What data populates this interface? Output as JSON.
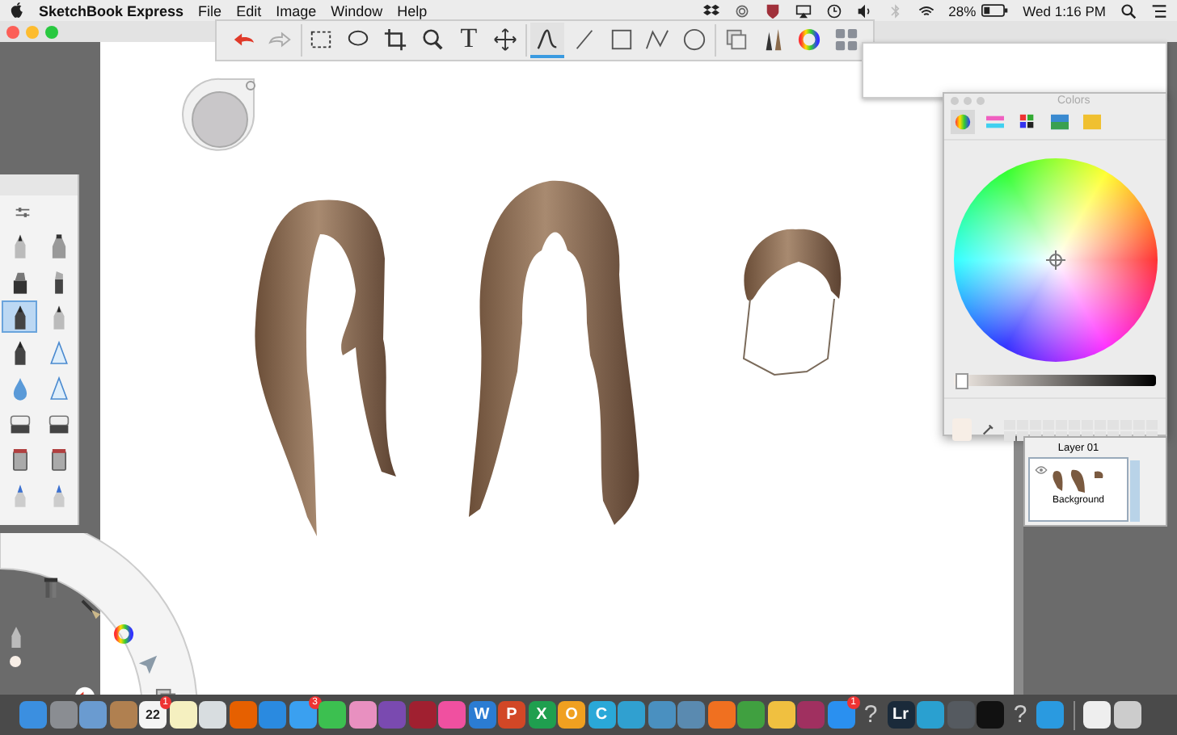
{
  "menu_bar": {
    "app_name": "SketchBook Express",
    "menus": [
      "File",
      "Edit",
      "Image",
      "Window",
      "Help"
    ],
    "battery": "28%",
    "clock": "Wed 1:16 PM"
  },
  "toolbar": {
    "tools": [
      {
        "kind": "undo",
        "selected": false
      },
      {
        "kind": "redo",
        "selected": false
      },
      {
        "kind": "rect-select",
        "selected": false
      },
      {
        "kind": "lasso",
        "selected": false
      },
      {
        "kind": "crop",
        "selected": false
      },
      {
        "kind": "zoom",
        "selected": false
      },
      {
        "kind": "text",
        "label": "T",
        "selected": false
      },
      {
        "kind": "move",
        "selected": false
      },
      {
        "kind": "curve",
        "selected": true
      },
      {
        "kind": "line",
        "selected": false
      },
      {
        "kind": "rect",
        "selected": false
      },
      {
        "kind": "polyline",
        "selected": false
      },
      {
        "kind": "ellipse",
        "selected": false
      },
      {
        "kind": "layers",
        "selected": false
      },
      {
        "kind": "brushes",
        "selected": false
      },
      {
        "kind": "color",
        "selected": false
      },
      {
        "kind": "panels",
        "selected": false
      }
    ]
  },
  "brush_palette": {
    "brushes": [
      {
        "kind": "pencil",
        "selected": false
      },
      {
        "kind": "airbrush",
        "selected": false
      },
      {
        "kind": "marker",
        "selected": false
      },
      {
        "kind": "chisel",
        "selected": false
      },
      {
        "kind": "pen",
        "selected": true
      },
      {
        "kind": "pencil",
        "selected": false
      },
      {
        "kind": "pen",
        "selected": false
      },
      {
        "kind": "triangle",
        "selected": false
      },
      {
        "kind": "drop",
        "selected": false
      },
      {
        "kind": "triangle",
        "selected": false
      },
      {
        "kind": "eraser",
        "selected": false
      },
      {
        "kind": "eraser",
        "selected": false
      },
      {
        "kind": "bucket",
        "selected": false
      },
      {
        "kind": "bucket",
        "selected": false
      },
      {
        "kind": "highlighter",
        "selected": false
      },
      {
        "kind": "highlighter",
        "selected": false
      }
    ]
  },
  "colors_panel": {
    "title": "Colors",
    "tabs": [
      {
        "kind": "wheel",
        "selected": true
      },
      {
        "kind": "sliders",
        "selected": false
      },
      {
        "kind": "palette",
        "selected": false
      },
      {
        "kind": "image",
        "selected": false
      },
      {
        "kind": "crayons",
        "selected": false
      }
    ],
    "brightness": {
      "level": 0.03
    }
  },
  "layers_panel": {
    "layers": [
      {
        "name": "Layer 01"
      },
      {
        "name": "Background",
        "selected": true
      }
    ]
  },
  "dock": [
    {
      "kind": "app",
      "color": "#3b8fe0"
    },
    {
      "kind": "app",
      "color": "#8a8d92"
    },
    {
      "kind": "app",
      "color": "#6a9bd0"
    },
    {
      "kind": "app",
      "color": "#b08050"
    },
    {
      "kind": "app",
      "color": "#f4f4f4",
      "label": "22",
      "badge": "1"
    },
    {
      "kind": "app",
      "color": "#f5f0c0"
    },
    {
      "kind": "app",
      "color": "#d8dde0"
    },
    {
      "kind": "app",
      "color": "#e66000"
    },
    {
      "kind": "app",
      "color": "#2a8ae0"
    },
    {
      "kind": "app",
      "color": "#3aa0f0",
      "badge": "3"
    },
    {
      "kind": "app",
      "color": "#3cc050"
    },
    {
      "kind": "app",
      "color": "#e890c0"
    },
    {
      "kind": "app",
      "color": "#7a4ab0"
    },
    {
      "kind": "app",
      "color": "#a02030"
    },
    {
      "kind": "app",
      "color": "#f050a0"
    },
    {
      "kind": "app",
      "color": "#2b7cd3",
      "label": "W"
    },
    {
      "kind": "app",
      "color": "#d24726",
      "label": "P"
    },
    {
      "kind": "app",
      "color": "#1f9f4f",
      "label": "X"
    },
    {
      "kind": "app",
      "color": "#f0a020",
      "label": "O"
    },
    {
      "kind": "app",
      "color": "#2aa8d8",
      "label": "C"
    },
    {
      "kind": "app",
      "color": "#30a0d0"
    },
    {
      "kind": "app",
      "color": "#4a90c0"
    },
    {
      "kind": "app",
      "color": "#5a8ab0"
    },
    {
      "kind": "app",
      "color": "#f07020"
    },
    {
      "kind": "app",
      "color": "#40a040"
    },
    {
      "kind": "app",
      "color": "#f0c040"
    },
    {
      "kind": "app",
      "color": "#a03060"
    },
    {
      "kind": "app",
      "color": "#2a90f0",
      "badge": "1"
    },
    {
      "kind": "missing",
      "label": "?"
    },
    {
      "kind": "app",
      "color": "#1a2a3a",
      "label": "Lr"
    },
    {
      "kind": "app",
      "color": "#2aa0d0"
    },
    {
      "kind": "app",
      "color": "#555a60"
    },
    {
      "kind": "app",
      "color": "#111111"
    },
    {
      "kind": "missing",
      "label": "?"
    },
    {
      "kind": "app",
      "color": "#2a9ae0"
    },
    {
      "kind": "separator"
    },
    {
      "kind": "app",
      "color": "#eeeeee"
    },
    {
      "kind": "app",
      "color": "#cccccc"
    }
  ]
}
